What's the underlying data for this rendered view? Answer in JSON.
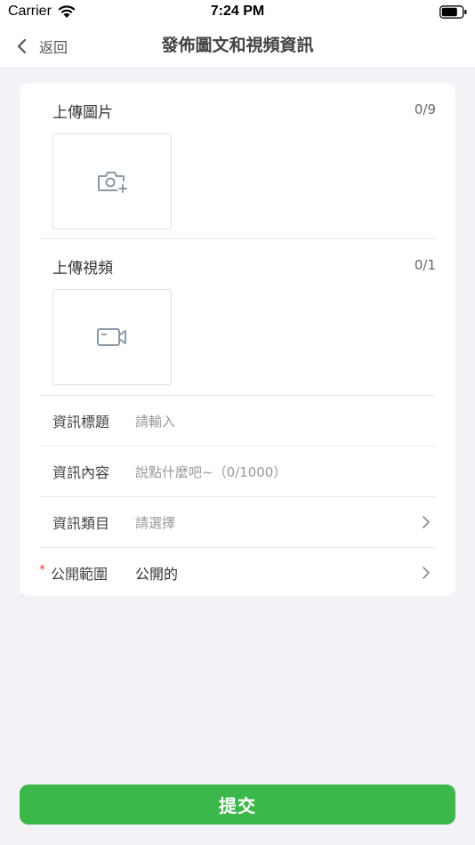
{
  "status_bar": {
    "carrier": "Carrier",
    "time": "7:24 PM"
  },
  "nav": {
    "back_label": "返回",
    "title": "發佈圖文和視頻資訊"
  },
  "image_upload": {
    "title": "上傳圖片",
    "count": "0/9",
    "icon": "camera-plus-icon"
  },
  "video_upload": {
    "title": "上傳視頻",
    "count": "0/1",
    "icon": "video-camera-icon"
  },
  "form": {
    "rows": [
      {
        "label": "資訊標題",
        "placeholder": "請輸入",
        "required": false,
        "has_chevron": false
      },
      {
        "label": "資訊內容",
        "placeholder": "說點什麼吧~（0/1000）",
        "required": false,
        "has_chevron": false
      },
      {
        "label": "資訊類目",
        "placeholder": "請選擇",
        "required": false,
        "has_chevron": true
      },
      {
        "label": "公開範圍",
        "value": "公開的",
        "required": true,
        "required_mark": "*",
        "has_chevron": true
      }
    ]
  },
  "submit": {
    "label": "提交",
    "color": "#3cb74a"
  },
  "colors": {
    "background": "#f2f2f7",
    "card": "#ffffff",
    "required": "#e64340",
    "placeholder": "#999999"
  }
}
